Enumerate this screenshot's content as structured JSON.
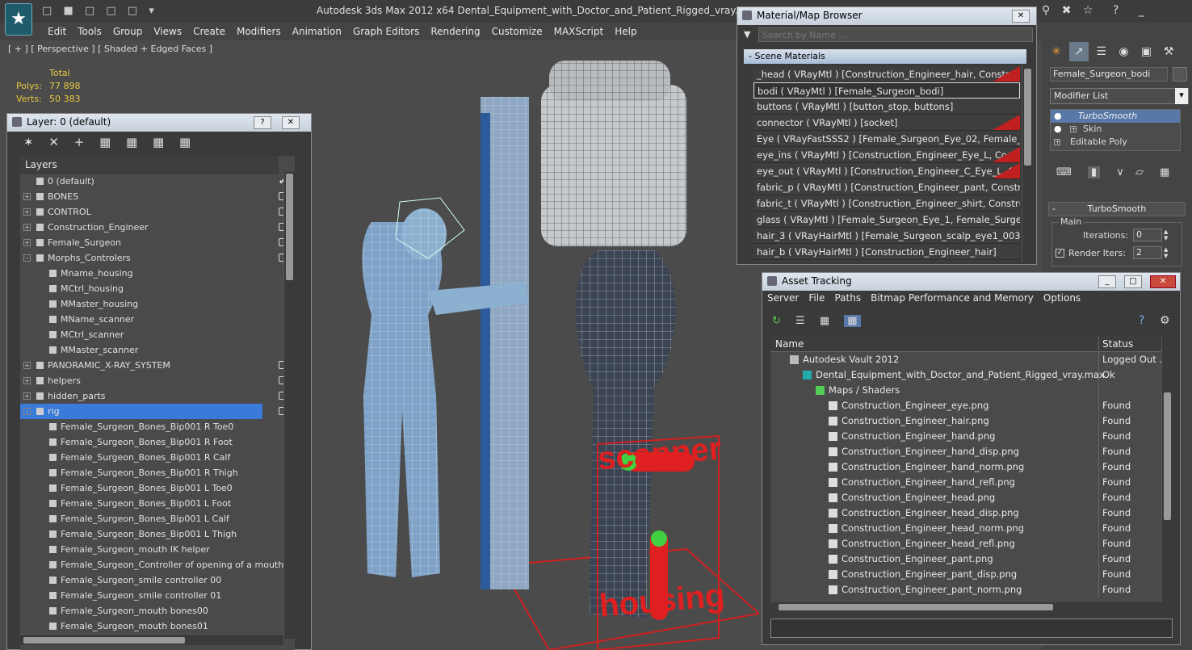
{
  "app": {
    "title": "Autodesk 3ds Max  2012 x64     Dental_Equipment_with_Doctor_and_Patient_Rigged_vray.max"
  },
  "menu": [
    "Edit",
    "Tools",
    "Group",
    "Views",
    "Create",
    "Modifiers",
    "Animation",
    "Graph Editors",
    "Rendering",
    "Customize",
    "MAXScript",
    "Help"
  ],
  "viewport": {
    "label": "[ + ] [ Perspective ] [ Shaded + Edged Faces ]",
    "total_label": "Total",
    "polys_label": "Polys:",
    "polys_value": "77 898",
    "verts_label": "Verts:",
    "verts_value": "50 383",
    "overlay1": "scanner",
    "overlay2": "housing"
  },
  "layer_win": {
    "title": "Layer: 0 (default)",
    "header": "Layers",
    "items": [
      {
        "label": "0 (default)",
        "indent": 1,
        "exp": "",
        "check": "tick"
      },
      {
        "label": "BONES",
        "indent": 1,
        "exp": "+",
        "check": "box"
      },
      {
        "label": "CONTROL",
        "indent": 1,
        "exp": "+",
        "check": "box"
      },
      {
        "label": "Construction_Engineer",
        "indent": 1,
        "exp": "+",
        "check": "box"
      },
      {
        "label": "Female_Surgeon",
        "indent": 1,
        "exp": "+",
        "check": "box"
      },
      {
        "label": "Morphs_Controlers",
        "indent": 1,
        "exp": "-",
        "check": "box"
      },
      {
        "label": "Mname_housing",
        "indent": 2,
        "exp": "",
        "check": ""
      },
      {
        "label": "MCtrl_housing",
        "indent": 2,
        "exp": "",
        "check": ""
      },
      {
        "label": "MMaster_housing",
        "indent": 2,
        "exp": "",
        "check": ""
      },
      {
        "label": "MName_scanner",
        "indent": 2,
        "exp": "",
        "check": ""
      },
      {
        "label": "MCtrl_scanner",
        "indent": 2,
        "exp": "",
        "check": ""
      },
      {
        "label": "MMaster_scanner",
        "indent": 2,
        "exp": "",
        "check": ""
      },
      {
        "label": "PANORAMIC_X-RAY_SYSTEM",
        "indent": 1,
        "exp": "+",
        "check": "box"
      },
      {
        "label": "helpers",
        "indent": 1,
        "exp": "+",
        "check": "box"
      },
      {
        "label": "hidden_parts",
        "indent": 1,
        "exp": "+",
        "check": "box"
      },
      {
        "label": "rig",
        "indent": 1,
        "exp": "-",
        "check": "box",
        "selected": true
      },
      {
        "label": "Female_Surgeon_Bones_Bip001 R Toe0",
        "indent": 2,
        "exp": "",
        "check": ""
      },
      {
        "label": "Female_Surgeon_Bones_Bip001 R Foot",
        "indent": 2,
        "exp": "",
        "check": ""
      },
      {
        "label": "Female_Surgeon_Bones_Bip001 R Calf",
        "indent": 2,
        "exp": "",
        "check": ""
      },
      {
        "label": "Female_Surgeon_Bones_Bip001 R Thigh",
        "indent": 2,
        "exp": "",
        "check": ""
      },
      {
        "label": "Female_Surgeon_Bones_Bip001 L Toe0",
        "indent": 2,
        "exp": "",
        "check": ""
      },
      {
        "label": "Female_Surgeon_Bones_Bip001 L Foot",
        "indent": 2,
        "exp": "",
        "check": ""
      },
      {
        "label": "Female_Surgeon_Bones_Bip001 L Calf",
        "indent": 2,
        "exp": "",
        "check": ""
      },
      {
        "label": "Female_Surgeon_Bones_Bip001 L Thigh",
        "indent": 2,
        "exp": "",
        "check": ""
      },
      {
        "label": "Female_Surgeon_mouth IK helper",
        "indent": 2,
        "exp": "",
        "check": ""
      },
      {
        "label": "Female_Surgeon_Controller of opening of a mouth",
        "indent": 2,
        "exp": "",
        "check": ""
      },
      {
        "label": "Female_Surgeon_smile controller 00",
        "indent": 2,
        "exp": "",
        "check": ""
      },
      {
        "label": "Female_Surgeon_smile controller 01",
        "indent": 2,
        "exp": "",
        "check": ""
      },
      {
        "label": "Female_Surgeon_mouth bones00",
        "indent": 2,
        "exp": "",
        "check": ""
      },
      {
        "label": "Female_Surgeon_mouth bones01",
        "indent": 2,
        "exp": "",
        "check": ""
      }
    ]
  },
  "mat_win": {
    "title": "Material/Map Browser",
    "search_placeholder": "Search by Name ...",
    "section": "- Scene Materials",
    "items": [
      {
        "label": "_head  ( VRayMtl )  [Construction_Engineer_hair, Construction...",
        "red": true
      },
      {
        "label": "bodi  ( VRayMtl )  [Female_Surgeon_bodi]",
        "red": false,
        "selected": true
      },
      {
        "label": "buttons  ( VRayMtl )  [button_stop, buttons]",
        "red": false
      },
      {
        "label": "connector  ( VRayMtl )  [socket]",
        "red": true
      },
      {
        "label": "Eye   ( VRayFastSSS2 )  [Female_Surgeon_Eye_02, Female_Su...",
        "red": false
      },
      {
        "label": "eye_ins  ( VRayMtl )  [Construction_Engineer_Eye_L, Construc...",
        "red": true
      },
      {
        "label": "eye_out  ( VRayMtl )  [Construction_Engineer_C_Eye_L, Const...",
        "red": true
      },
      {
        "label": "fabric_p  ( VRayMtl )  [Construction_Engineer_pant, Constructi...",
        "red": false
      },
      {
        "label": "fabric_t  ( VRayMtl )  [Construction_Engineer_shirt, Constructi...",
        "red": false
      },
      {
        "label": "glass  ( VRayMtl )  [Female_Surgeon_Eye_1, Female_Surgeon...",
        "red": false
      },
      {
        "label": "hair_3  ( VRayHairMtl )  [Female_Surgeon_scalp_eye1_003, F...",
        "red": false
      },
      {
        "label": "hair_b  ( VRayHairMtl )  [Construction_Engineer_hair]",
        "red": false
      }
    ]
  },
  "cmd": {
    "object_name": "Female_Surgeon_bodi",
    "modifier_list": "Modifier List",
    "stack": [
      "TurboSmooth",
      "Skin",
      "Editable Poly"
    ],
    "rollout": "TurboSmooth",
    "group": "Main",
    "iterations_label": "Iterations:",
    "iterations_value": "0",
    "render_iters_label": "Render Iters:",
    "render_iters_value": "2"
  },
  "asset_win": {
    "title": "Asset Tracking",
    "menu": [
      "Server",
      "File",
      "Paths",
      "Bitmap Performance and Memory",
      "Options"
    ],
    "col_name": "Name",
    "col_status": "Status",
    "rows": [
      {
        "name": "Autodesk Vault 2012",
        "status": "Logged Out ...",
        "level": 1,
        "kind": "vault"
      },
      {
        "name": "Dental_Equipment_with_Doctor_and_Patient_Rigged_vray.max",
        "status": "Ok",
        "level": 2,
        "kind": "max"
      },
      {
        "name": "Maps / Shaders",
        "status": "",
        "level": 3,
        "kind": "maps"
      },
      {
        "name": "Construction_Engineer_eye.png",
        "status": "Found",
        "level": 4,
        "kind": "file"
      },
      {
        "name": "Construction_Engineer_hair.png",
        "status": "Found",
        "level": 4,
        "kind": "file"
      },
      {
        "name": "Construction_Engineer_hand.png",
        "status": "Found",
        "level": 4,
        "kind": "file"
      },
      {
        "name": "Construction_Engineer_hand_disp.png",
        "status": "Found",
        "level": 4,
        "kind": "file"
      },
      {
        "name": "Construction_Engineer_hand_norm.png",
        "status": "Found",
        "level": 4,
        "kind": "file"
      },
      {
        "name": "Construction_Engineer_hand_refl.png",
        "status": "Found",
        "level": 4,
        "kind": "file"
      },
      {
        "name": "Construction_Engineer_head.png",
        "status": "Found",
        "level": 4,
        "kind": "file"
      },
      {
        "name": "Construction_Engineer_head_disp.png",
        "status": "Found",
        "level": 4,
        "kind": "file"
      },
      {
        "name": "Construction_Engineer_head_norm.png",
        "status": "Found",
        "level": 4,
        "kind": "file"
      },
      {
        "name": "Construction_Engineer_head_refl.png",
        "status": "Found",
        "level": 4,
        "kind": "file"
      },
      {
        "name": "Construction_Engineer_pant.png",
        "status": "Found",
        "level": 4,
        "kind": "file"
      },
      {
        "name": "Construction_Engineer_pant_disp.png",
        "status": "Found",
        "level": 4,
        "kind": "file"
      },
      {
        "name": "Construction_Engineer_pant_norm.png",
        "status": "Found",
        "level": 4,
        "kind": "file"
      }
    ]
  }
}
